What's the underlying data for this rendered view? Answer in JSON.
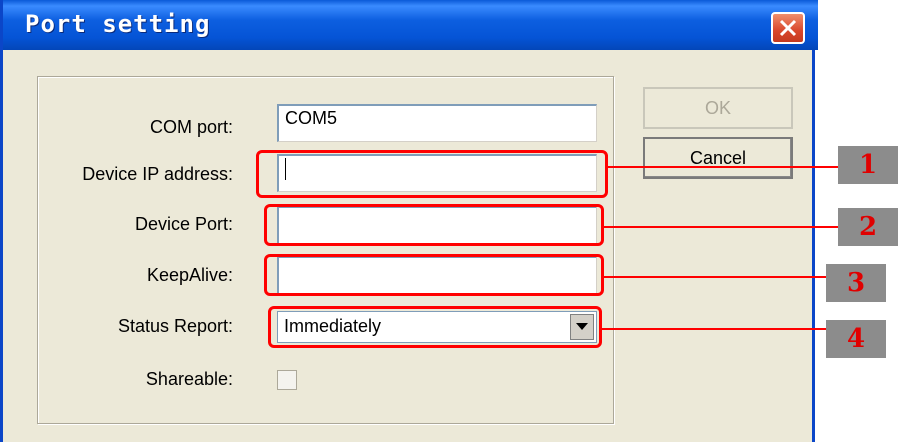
{
  "window": {
    "title": "Port setting"
  },
  "form": {
    "com_port": {
      "label": "COM port:",
      "value": "COM5"
    },
    "device_ip": {
      "label": "Device IP address:",
      "value": ""
    },
    "device_port": {
      "label": "Device Port:",
      "value": ""
    },
    "keepalive": {
      "label": "KeepAlive:",
      "value": ""
    },
    "status_report": {
      "label": "Status Report:",
      "value": "Immediately"
    },
    "shareable": {
      "label": "Shareable:",
      "checked": false
    }
  },
  "buttons": {
    "ok": "OK",
    "cancel": "Cancel"
  },
  "callouts": [
    "1",
    "2",
    "3",
    "4"
  ],
  "colors": {
    "accent": "#0b46c8",
    "callout": "#ff0000",
    "callout_box": "#8c8c8c"
  }
}
